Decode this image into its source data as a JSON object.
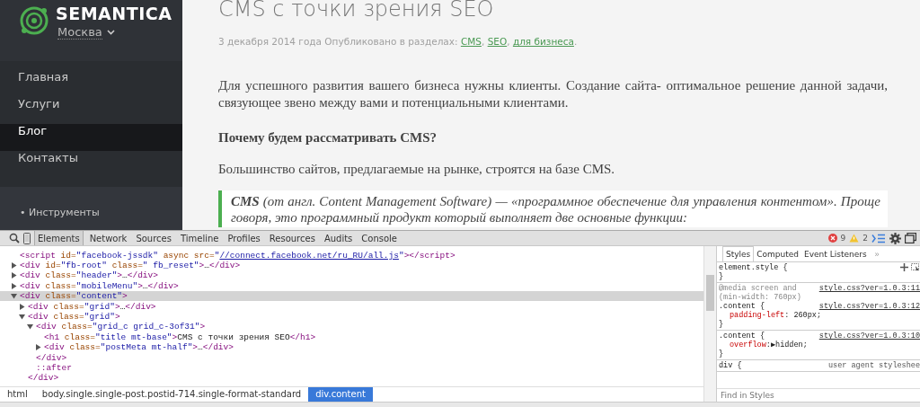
{
  "sidebar": {
    "logo": "SEMANTICA",
    "city": "Москва",
    "menu": [
      {
        "label": "Главная",
        "selected": false
      },
      {
        "label": "Услуги",
        "selected": false
      },
      {
        "label": "Блог",
        "selected": true
      },
      {
        "label": "Контакты",
        "selected": false
      }
    ],
    "submenu": [
      {
        "bullet": "•",
        "label": "Инструменты"
      }
    ]
  },
  "article": {
    "title": "CMS с точки зрения SEO",
    "meta": [
      {
        "kind": "text",
        "text": "3 декабря 2014 года Опубликовано в разделах: "
      },
      {
        "kind": "link",
        "text": "CMS"
      },
      {
        "kind": "text",
        "text": ", "
      },
      {
        "kind": "link",
        "text": "SEO"
      },
      {
        "kind": "text",
        "text": ", "
      },
      {
        "kind": "link",
        "text": "для бизнеса"
      },
      {
        "kind": "text",
        "text": "."
      }
    ],
    "blocks": [
      {
        "kind": "paragraph",
        "text": "Для успешного развития вашего бизнеса нужны клиенты. Создание сайта- оптимальное решение данной задачи, связующее звено между вами и потенциальными клиентами."
      },
      {
        "kind": "heading",
        "text": "Почему будем рассматривать CMS?"
      },
      {
        "kind": "paragraph",
        "text": "Большинство сайтов, предлагаемые на рынке, строятся на базе CMS."
      },
      {
        "kind": "quote",
        "text": "**CMS** (от англ. Content Management Software) — «программное обеспечение для управления контентом». Проще говоря, это программный продукт который выполняет две основные функции:"
      }
    ]
  },
  "devtools": {
    "tabs": [
      {
        "label": "Elements",
        "selected": true
      },
      {
        "label": "Network",
        "selected": false
      },
      {
        "label": "Sources",
        "selected": false
      },
      {
        "label": "Timeline",
        "selected": false
      },
      {
        "label": "Profiles",
        "selected": false
      },
      {
        "label": "Resources",
        "selected": false
      },
      {
        "label": "Audits",
        "selected": false
      },
      {
        "label": "Console",
        "selected": false
      }
    ],
    "errors": "9",
    "warnings": "2",
    "tree": [
      {
        "selected": false,
        "parts": [
          {
            "kind": "tag",
            "text": "<script"
          },
          {
            "kind": "attr",
            "text": " id="
          },
          {
            "kind": "value",
            "text": "\"facebook-jssdk\""
          },
          {
            "kind": "attr",
            "text": " async src="
          },
          {
            "kind": "value",
            "text": "\""
          },
          {
            "kind": "link",
            "text": "//connect.facebook.net/ru_RU/all.js"
          },
          {
            "kind": "value",
            "text": "\""
          },
          {
            "kind": "tag",
            "text": "></script>"
          }
        ]
      },
      {
        "expanded": false,
        "selected": false,
        "parts": [
          {
            "kind": "tag",
            "text": "<div"
          },
          {
            "kind": "attr",
            "text": " id="
          },
          {
            "kind": "value",
            "text": "\"fb-root\""
          },
          {
            "kind": "attr",
            "text": " class="
          },
          {
            "kind": "value",
            "text": "\" fb_reset\""
          },
          {
            "kind": "tag",
            "text": ">"
          },
          {
            "kind": "text",
            "text": "…"
          },
          {
            "kind": "tag",
            "text": "</div>"
          }
        ]
      },
      {
        "expanded": false,
        "selected": false,
        "parts": [
          {
            "kind": "tag",
            "text": "<div"
          },
          {
            "kind": "attr",
            "text": " class="
          },
          {
            "kind": "value",
            "text": "\"header\""
          },
          {
            "kind": "tag",
            "text": ">"
          },
          {
            "kind": "text",
            "text": "…"
          },
          {
            "kind": "tag",
            "text": "</div>"
          }
        ]
      },
      {
        "expanded": false,
        "selected": false,
        "parts": [
          {
            "kind": "tag",
            "text": "<div"
          },
          {
            "kind": "attr",
            "text": " class="
          },
          {
            "kind": "value",
            "text": "\"mobileMenu\""
          },
          {
            "kind": "tag",
            "text": ">"
          },
          {
            "kind": "text",
            "text": "…"
          },
          {
            "kind": "tag",
            "text": "</div>"
          }
        ]
      },
      {
        "expanded": true,
        "selected": true,
        "parts": [
          {
            "kind": "tag",
            "text": "<div"
          },
          {
            "kind": "attr",
            "text": " class="
          },
          {
            "kind": "value",
            "text": "\"content\""
          },
          {
            "kind": "tag",
            "text": ">"
          }
        ],
        "children": [
          {
            "expanded": false,
            "selected": false,
            "parts": [
              {
                "kind": "tag",
                "text": "<div"
              },
              {
                "kind": "attr",
                "text": " class="
              },
              {
                "kind": "value",
                "text": "\"grid\""
              },
              {
                "kind": "tag",
                "text": ">"
              },
              {
                "kind": "text",
                "text": "…"
              },
              {
                "kind": "tag",
                "text": "</div>"
              }
            ]
          },
          {
            "expanded": true,
            "selected": false,
            "parts": [
              {
                "kind": "tag",
                "text": "<div"
              },
              {
                "kind": "attr",
                "text": " class="
              },
              {
                "kind": "value",
                "text": "\"grid\""
              },
              {
                "kind": "tag",
                "text": ">"
              }
            ],
            "children": [
              {
                "expanded": true,
                "selected": false,
                "parts": [
                  {
                    "kind": "tag",
                    "text": "<div"
                  },
                  {
                    "kind": "attr",
                    "text": " class="
                  },
                  {
                    "kind": "value",
                    "text": "\"grid_c grid_c-3of31\""
                  },
                  {
                    "kind": "tag",
                    "text": ">"
                  }
                ],
                "children": [
                  {
                    "selected": false,
                    "parts": [
                      {
                        "kind": "tag",
                        "text": "<h1"
                      },
                      {
                        "kind": "attr",
                        "text": " class="
                      },
                      {
                        "kind": "value",
                        "text": "\"title mt-base\""
                      },
                      {
                        "kind": "tag",
                        "text": ">"
                      },
                      {
                        "kind": "text",
                        "text": "CMS с точки зрения SEO"
                      },
                      {
                        "kind": "tag",
                        "text": "</h1>"
                      }
                    ]
                  },
                  {
                    "expanded": false,
                    "selected": false,
                    "parts": [
                      {
                        "kind": "tag",
                        "text": "<div"
                      },
                      {
                        "kind": "attr",
                        "text": " class="
                      },
                      {
                        "kind": "value",
                        "text": "\"postMeta mt-half\""
                      },
                      {
                        "kind": "tag",
                        "text": ">"
                      },
                      {
                        "kind": "text",
                        "text": "…"
                      },
                      {
                        "kind": "tag",
                        "text": "</div>"
                      }
                    ]
                  }
                ]
              },
              {
                "selected": false,
                "parts": [
                  {
                    "kind": "tag",
                    "text": "</div>"
                  }
                ]
              },
              {
                "selected": false,
                "parts": [
                  {
                    "kind": "pseudo",
                    "text": "::after"
                  }
                ]
              }
            ]
          },
          {
            "selected": false,
            "parts": [
              {
                "kind": "tag",
                "text": "</div>"
              }
            ]
          }
        ]
      }
    ],
    "breadcrumbs": [
      {
        "label": "html",
        "selected": false
      },
      {
        "label": "body.single.single-post.postid-714.single-format-standard",
        "selected": false
      },
      {
        "label": "div.content",
        "selected": true
      }
    ],
    "styles": {
      "tabs": [
        {
          "label": "Styles",
          "selected": true
        },
        {
          "label": "Computed",
          "selected": false
        },
        {
          "label": "Event Listeners",
          "selected": false
        }
      ],
      "more": "»",
      "rules": [
        {
          "kind": "inline",
          "selector": "element.style {",
          "close": "}"
        },
        {
          "kind": "matched",
          "media": "@media screen and (min-width: 760px)",
          "media_source": "style.css?ver=1.0.3:11",
          "selector": ".content {",
          "source": "style.css?ver=1.0.3:12",
          "props": [
            {
              "name": "padding-left",
              "value": ": 260px;"
            }
          ],
          "close": "}"
        },
        {
          "kind": "matched",
          "selector": ".content {",
          "source": "style.css?ver=1.0.3:10",
          "props": [
            {
              "name": "overflow",
              "value": ":▶hidden;"
            }
          ],
          "close": "}"
        },
        {
          "kind": "ua",
          "selector": "div {",
          "source": "user agent styleshee"
        }
      ],
      "filter": {
        "placeholder": "Find in Styles"
      }
    }
  }
}
